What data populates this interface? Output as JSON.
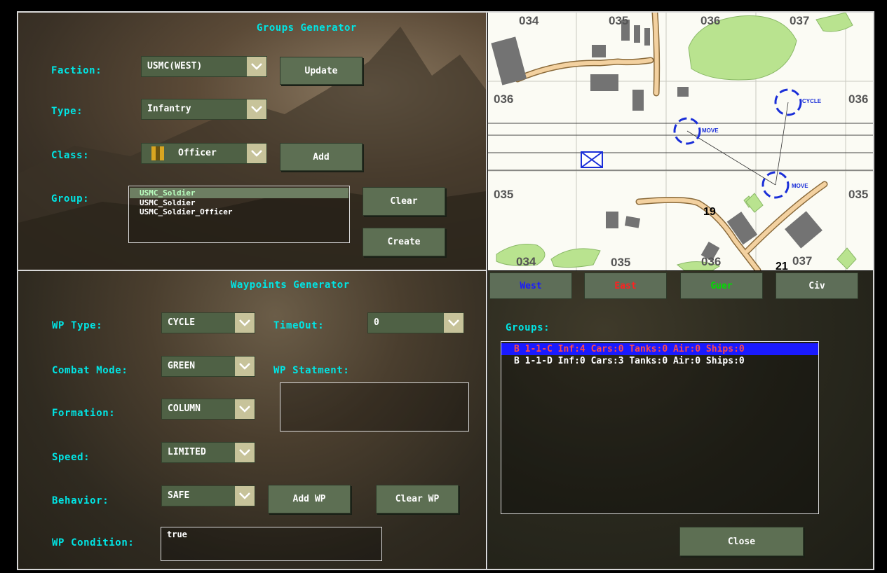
{
  "groups_generator": {
    "title": "Groups Generator",
    "faction_label": "Faction:",
    "faction_value": "USMC(WEST)",
    "update_button": "Update",
    "type_label": "Type:",
    "type_value": "Infantry",
    "class_label": "Class:",
    "class_value": "Officer",
    "add_button": "Add",
    "group_label": "Group:",
    "group_items": [
      "USMC_Soldier",
      "USMC_Soldier",
      "USMC_Soldier_Officer"
    ],
    "selected_index": 0,
    "clear_button": "Clear",
    "create_button": "Create"
  },
  "waypoints_generator": {
    "title": "Waypoints Generator",
    "wp_type_label": "WP Type:",
    "wp_type_value": "CYCLE",
    "timeout_label": "TimeOut:",
    "timeout_value": "0",
    "combat_mode_label": "Combat Mode:",
    "combat_mode_value": "GREEN",
    "wp_statement_label": "WP Statment:",
    "wp_statement_value": "",
    "formation_label": "Formation:",
    "formation_value": "COLUMN",
    "speed_label": "Speed:",
    "speed_value": "LIMITED",
    "behavior_label": "Behavior:",
    "behavior_value": "SAFE",
    "add_wp_button": "Add WP",
    "clear_wp_button": "Clear WP",
    "wp_condition_label": "WP Condition:",
    "wp_condition_value": "true"
  },
  "side_buttons": [
    {
      "label": "West",
      "color": "#1a1aff"
    },
    {
      "label": "East",
      "color": "#ff2020"
    },
    {
      "label": "Guer",
      "color": "#00dd00"
    },
    {
      "label": "Civ",
      "color": "#ffffff"
    }
  ],
  "groups_list": {
    "label": "Groups:",
    "items": [
      {
        "text": "B 1-1-C Inf:4 Cars:0 Tanks:0 Air:0 Ships:0",
        "selected": true,
        "color": "#ff4a4a"
      },
      {
        "text": "B 1-1-D Inf:0 Cars:3 Tanks:0 Air:0 Ships:0",
        "selected": false,
        "color": "#ffffff"
      }
    ]
  },
  "close_button": "Close",
  "map": {
    "grid_top": [
      "034",
      "035",
      "036",
      "037"
    ],
    "grid_bottom": [
      "034",
      "035",
      "036",
      "037"
    ],
    "grid_left": [
      "036",
      "035"
    ],
    "grid_right": [
      "036",
      "035"
    ],
    "waypoint_labels": [
      "MOVE",
      "CYCLE",
      "MOVE"
    ],
    "road_numbers": [
      "19",
      "21"
    ]
  }
}
